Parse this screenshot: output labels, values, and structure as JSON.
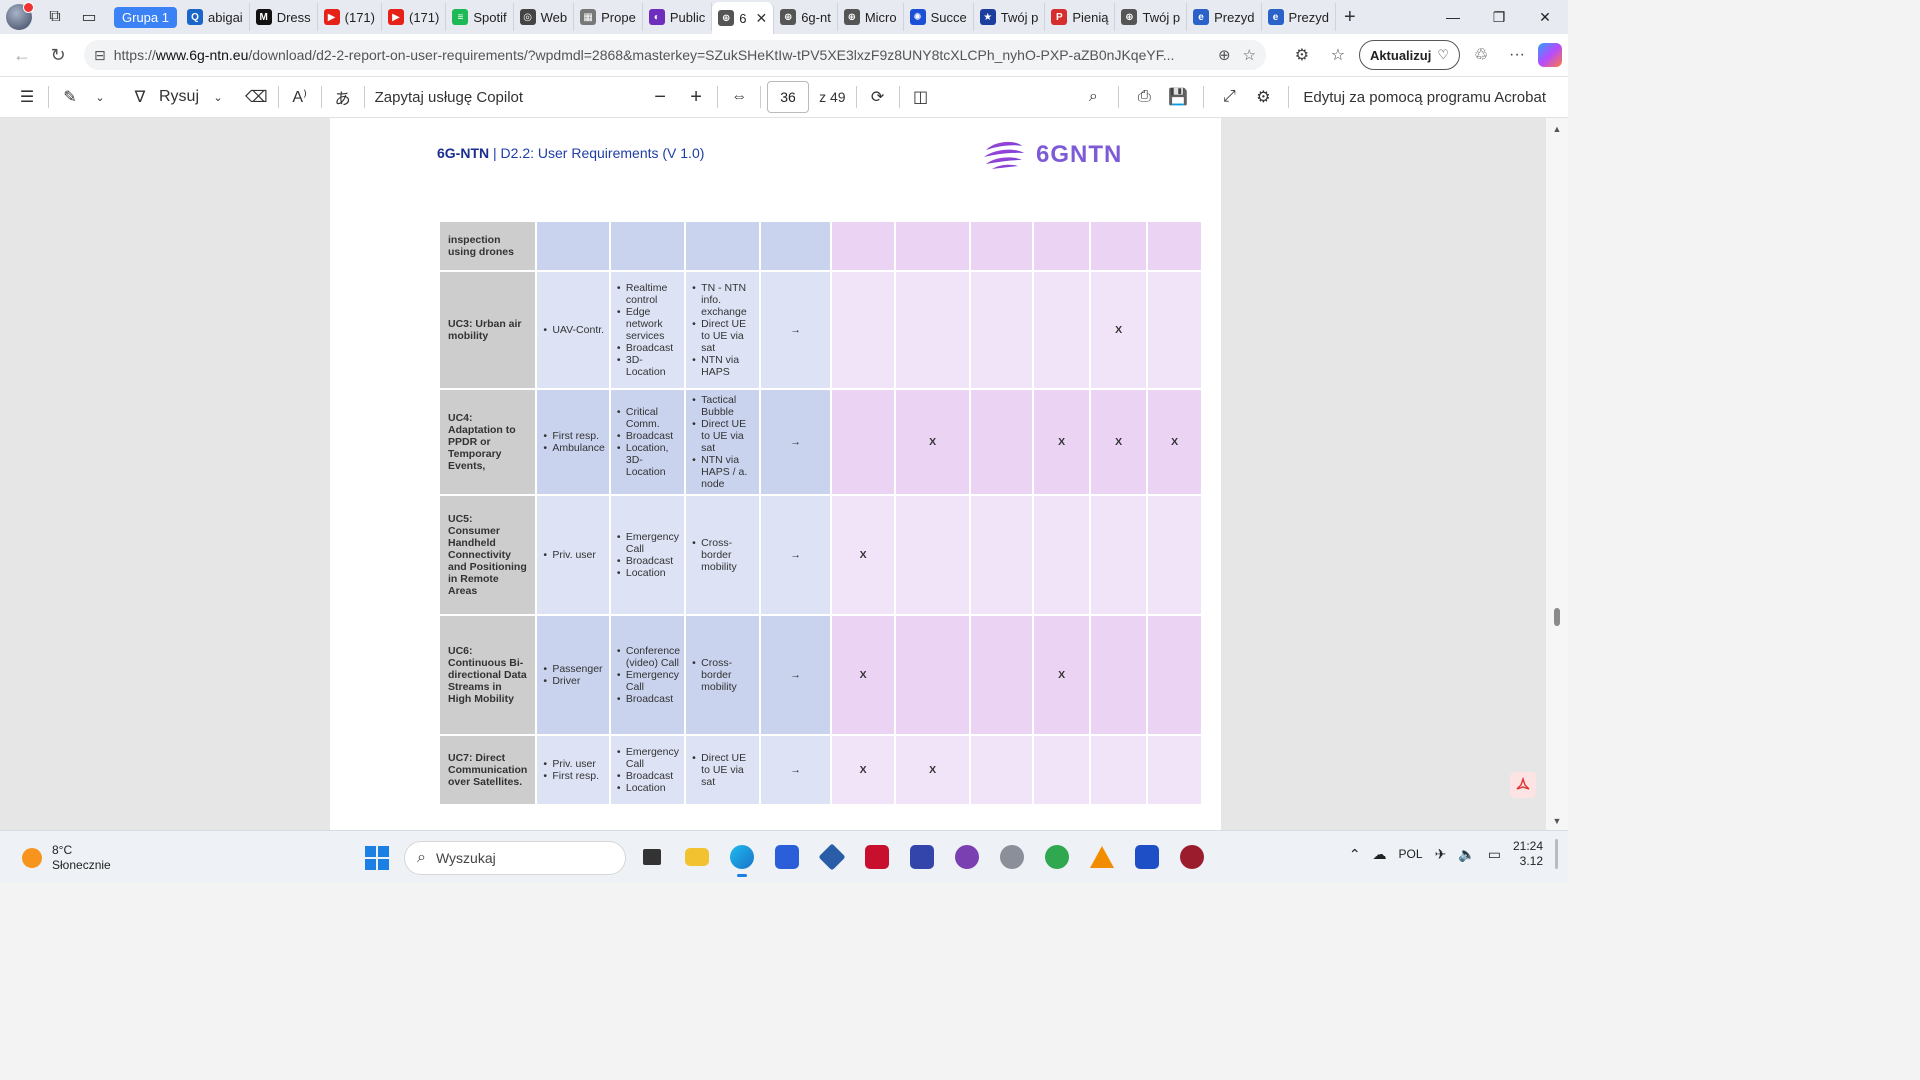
{
  "tabs": {
    "group_label": "Grupa 1",
    "items": [
      {
        "label": "abigai",
        "color": "#1b66c9",
        "glyph": "Q"
      },
      {
        "label": "Dress",
        "color": "#111111",
        "glyph": "M"
      },
      {
        "label": "(171)",
        "color": "#e62117",
        "glyph": "▶"
      },
      {
        "label": "(171)",
        "color": "#e62117",
        "glyph": "▶"
      },
      {
        "label": "Spotif",
        "color": "#1db954",
        "glyph": "≡"
      },
      {
        "label": "Web",
        "color": "#444444",
        "glyph": "◎"
      },
      {
        "label": "Prope",
        "color": "#777777",
        "glyph": "▦"
      },
      {
        "label": "Public",
        "color": "#6f2dbd",
        "glyph": "◐"
      },
      {
        "label": "6",
        "color": "#555555",
        "glyph": "⊕",
        "active": true
      },
      {
        "label": "6g-nt",
        "color": "#555555",
        "glyph": "⊕"
      },
      {
        "label": "Micro",
        "color": "#555555",
        "glyph": "⊕"
      },
      {
        "label": "Succe",
        "color": "#1a4fd6",
        "glyph": "✺"
      },
      {
        "label": "Twój p",
        "color": "#1b3d9e",
        "glyph": "★"
      },
      {
        "label": "Pienią",
        "color": "#d62d2d",
        "glyph": "P"
      },
      {
        "label": "Twój p",
        "color": "#555555",
        "glyph": "⊕"
      },
      {
        "label": "Prezyd",
        "color": "#2a62c9",
        "glyph": "e"
      },
      {
        "label": "Prezyd",
        "color": "#2a62c9",
        "glyph": "e"
      }
    ]
  },
  "address": {
    "url_prefix": "https://",
    "url_host": "www.6g-ntn.eu",
    "url_rest": "/download/d2-2-report-on-user-requirements/?wpdmdl=2868&masterkey=SZukSHeKtIw-tPV5XE3lxzF9z8UNY8tcXLCPh_nyhO-PXP-aZB0nJKqeYF...",
    "update_label": "Aktualizuj"
  },
  "pdf_toolbar": {
    "draw_label": "Rysuj",
    "copilot_label": "Zapytaj usługę Copilot",
    "page_current": "36",
    "page_total": "z 49",
    "acrobat_label": "Edytuj za pomocą programu Acrobat"
  },
  "document": {
    "header_project": "6G-NTN",
    "header_rest": " | D2.2: User Requirements (V 1.0)",
    "logo_text": "6GNTN",
    "rows": [
      {
        "uc": "inspection using drones",
        "c1": [],
        "c2": [],
        "c3": [],
        "arrow": "",
        "marks": [
          "",
          "",
          "",
          "",
          "",
          ""
        ],
        "shade": "A",
        "height": 50
      },
      {
        "uc": "UC3: Urban air mobility",
        "c1": [
          "UAV-Contr."
        ],
        "c2": [
          "Realtime control",
          "Edge network services",
          "Broadcast",
          "3D-Location"
        ],
        "c3": [
          "TN - NTN info. exchange",
          "Direct UE to UE via sat",
          "NTN via HAPS"
        ],
        "arrow": "→",
        "marks": [
          "",
          "",
          "",
          "",
          "X",
          ""
        ],
        "shade": "B",
        "height": 118
      },
      {
        "uc": "UC4: Adaptation to PPDR or Temporary Events,",
        "c1": [
          "First resp.",
          "Ambulance"
        ],
        "c2": [
          "Critical Comm.",
          "Broadcast",
          "Location, 3D-Location"
        ],
        "c3": [
          "Tactical Bubble",
          "Direct UE to UE via sat",
          "NTN via HAPS / a. node"
        ],
        "arrow": "→",
        "marks": [
          "",
          "X",
          "",
          "X",
          "X",
          "X"
        ],
        "shade": "A",
        "height": 106
      },
      {
        "uc": "UC5: Consumer Handheld Connectivity and Positioning in Remote Areas",
        "c1": [
          "Priv. user"
        ],
        "c2": [
          "Emergency Call",
          "Broadcast",
          "Location"
        ],
        "c3": [
          "Cross-border mobility"
        ],
        "arrow": "→",
        "marks": [
          "X",
          "",
          "",
          "",
          "",
          ""
        ],
        "shade": "B",
        "height": 120
      },
      {
        "uc": "UC6: Continuous Bi-directional Data Streams in High Mobility",
        "c1": [
          "Passenger",
          "Driver"
        ],
        "c2": [
          "Conference (video) Call",
          "Emergency Call",
          "Broadcast"
        ],
        "c3": [
          "Cross-border mobility"
        ],
        "arrow": "→",
        "marks": [
          "X",
          "",
          "",
          "X",
          "",
          ""
        ],
        "shade": "A",
        "height": 120
      },
      {
        "uc": "UC7: Direct Communication over Satellites.",
        "c1": [
          "Priv. user",
          "First resp."
        ],
        "c2": [
          "Emergency Call",
          "Broadcast",
          "Location"
        ],
        "c3": [
          "Direct UE to UE via sat"
        ],
        "arrow": "→",
        "marks": [
          "X",
          "X",
          "",
          "",
          "",
          ""
        ],
        "shade": "B",
        "height": 70
      }
    ]
  },
  "taskbar": {
    "temperature": "8°C",
    "weather": "Słonecznie",
    "search_placeholder": "Wyszukaj",
    "language": "POL",
    "time": "21:24",
    "date": "3.12"
  }
}
